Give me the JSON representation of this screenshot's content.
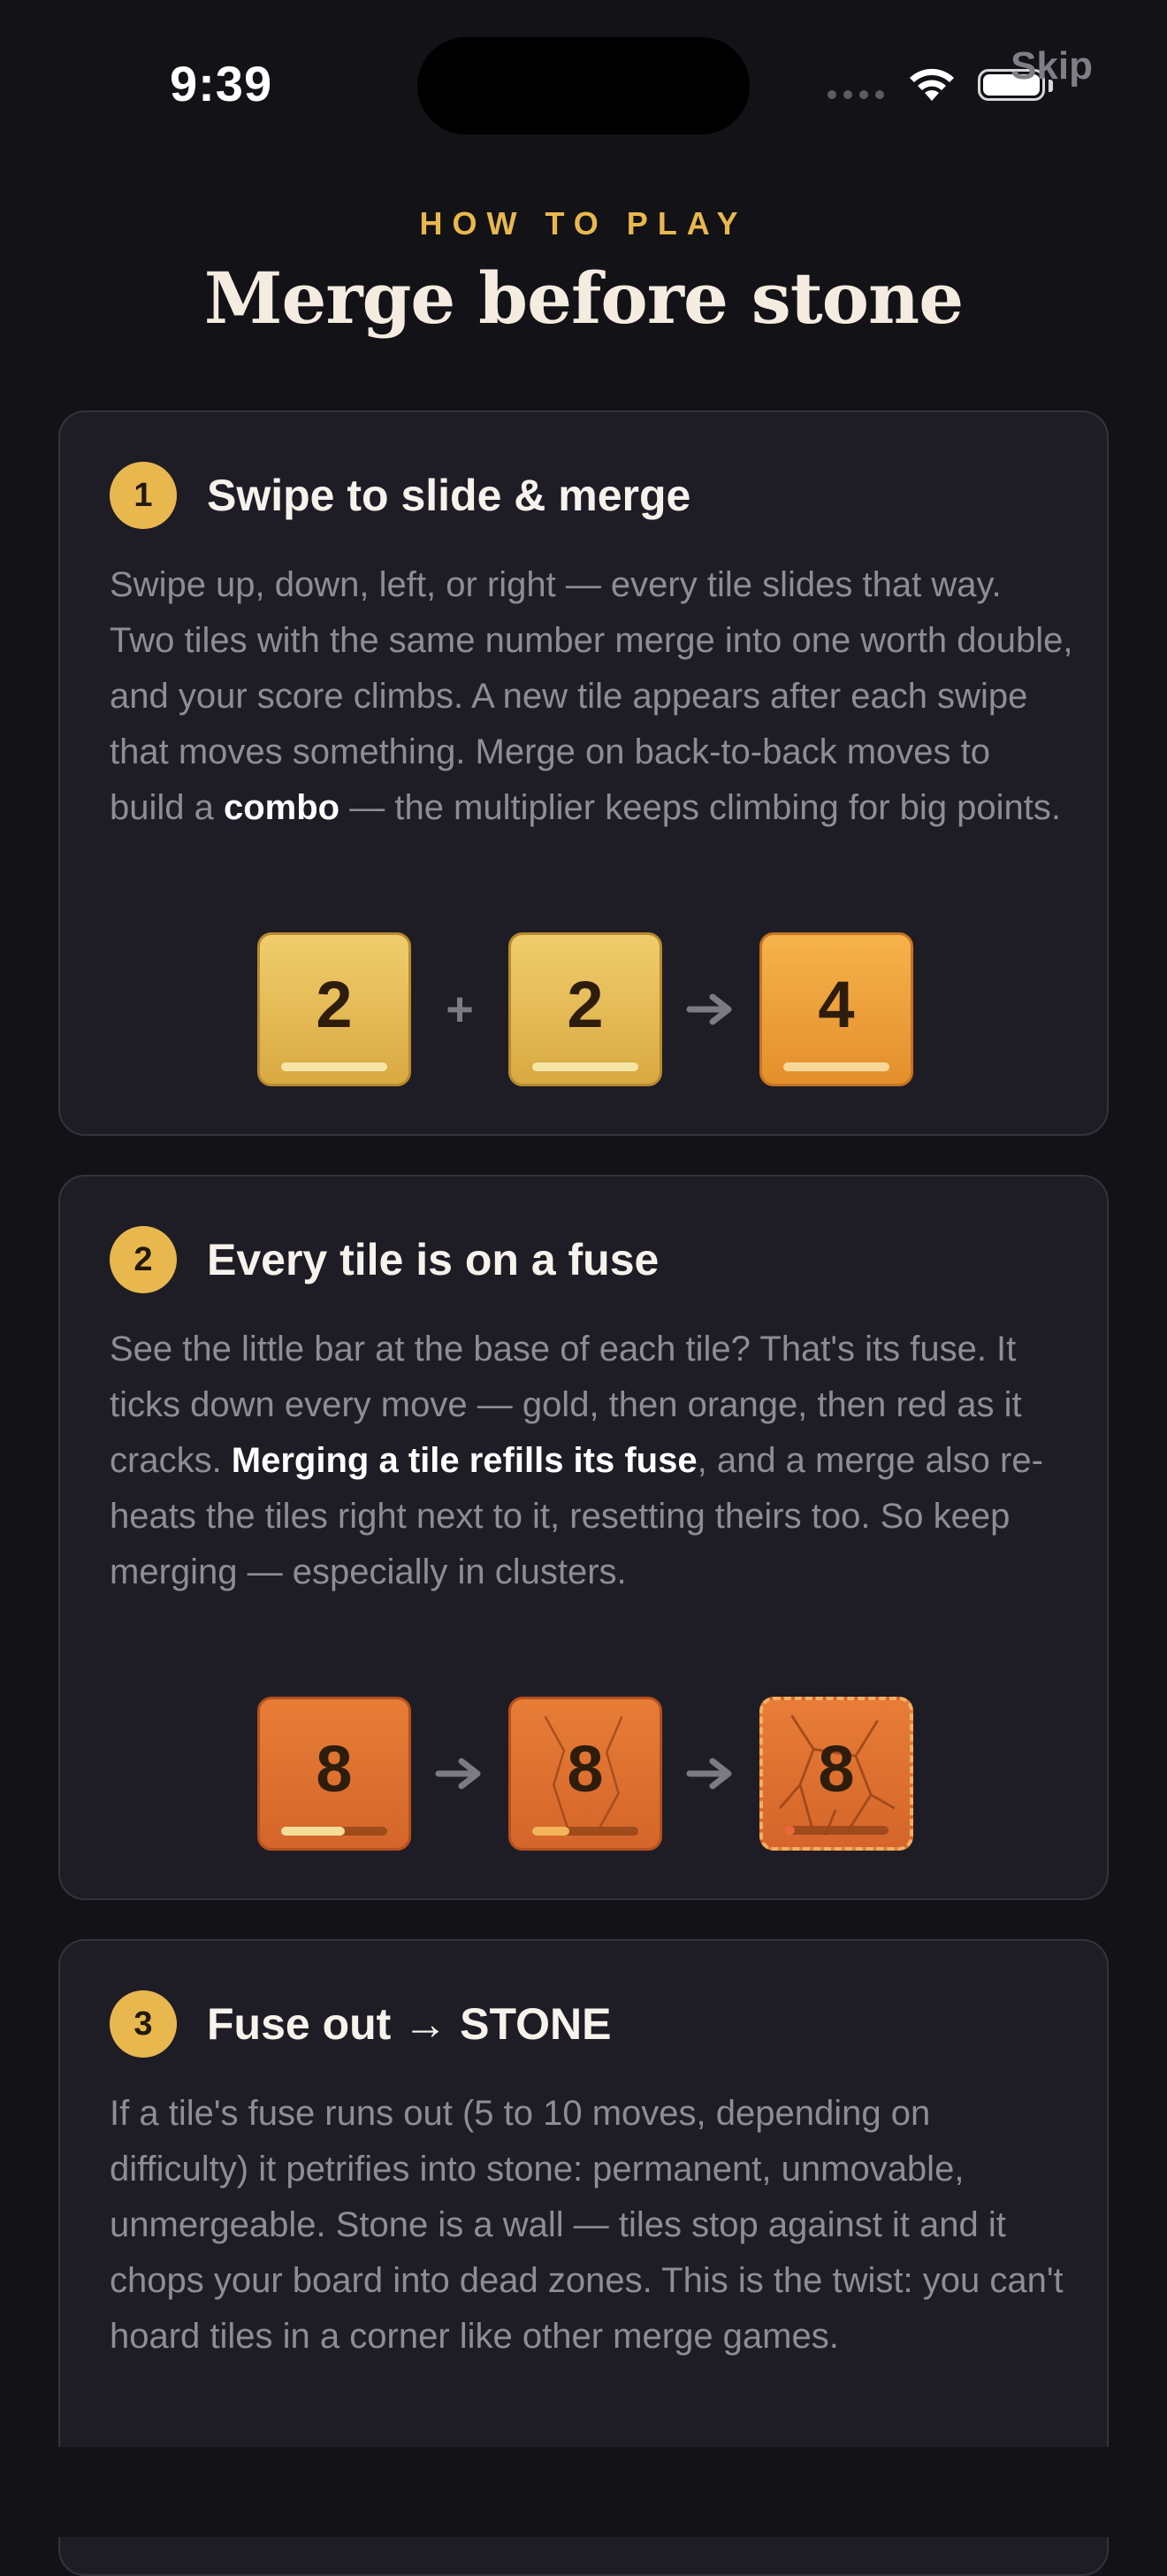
{
  "status_bar": {
    "time": "9:39"
  },
  "skip_label": "Skip",
  "header": {
    "eyebrow": "HOW TO PLAY",
    "title": "Merge before stone"
  },
  "cards": [
    {
      "number": "1",
      "title": "Swipe to slide & merge",
      "body_pre": "Swipe up, down, left, or right — every tile slides that way. Two tiles with the same number merge into one worth double, and your score climbs. A new tile appears after each swipe that moves something. Merge on back-to-back moves to build a ",
      "body_bold": "combo",
      "body_post": " — the multiplier keeps climbing for big points.",
      "demo": {
        "tile_a": "2",
        "plus": "+",
        "tile_b": "2",
        "result": "4"
      }
    },
    {
      "number": "2",
      "title": "Every tile is on a fuse",
      "body_pre": "See the little bar at the base of each tile? That's its fuse. It ticks down every move — gold, then orange, then red as it cracks. ",
      "body_bold": "Merging a tile refills its fuse",
      "body_post": ", and a merge also re-heats the tiles right next to it, resetting theirs too. So keep merging — especially in clusters.",
      "demo": {
        "tile_a": "8",
        "tile_b": "8",
        "tile_c": "8",
        "fuse_levels": [
          0.6,
          0.35,
          0.1
        ]
      }
    },
    {
      "number": "3",
      "title": "Fuse out → STONE",
      "body": "If a tile's fuse runs out (5 to 10 moves, depending on difficulty) it petrifies into stone: permanent, unmovable, unmergeable. Stone is a wall — tiles stop against it and it chops your board into dead zones. This is the twist: you can't hoard tiles in a corner like other merge games."
    }
  ],
  "icons": [
    "signal-dots-icon",
    "wifi-icon",
    "battery-icon",
    "arrow-right-icon",
    "crack-icon"
  ],
  "colors": {
    "accent": "#e8b84f",
    "background": "#131217",
    "card": "#1e1d26"
  }
}
